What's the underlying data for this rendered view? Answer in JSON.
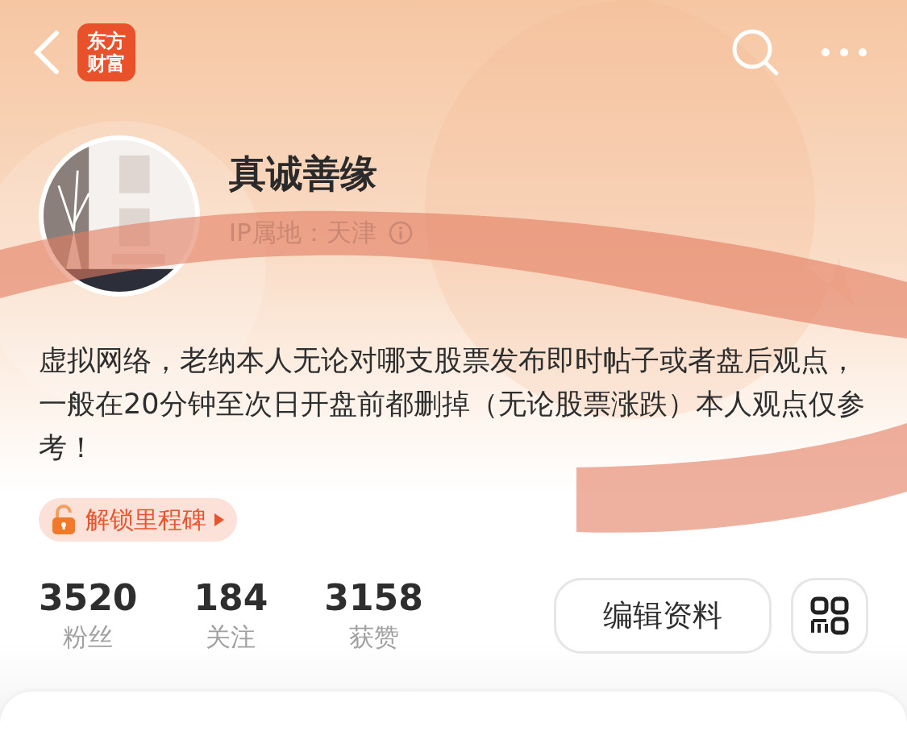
{
  "header": {
    "logo_lines": [
      "东方",
      "财富"
    ]
  },
  "profile": {
    "name": "真诚善缘",
    "ip_location": "IP属地：天津",
    "bio": "虚拟网络，老纳本人无论对哪支股票发布即时帖子或者盘后观点，一般在20分钟至次日开盘前都删掉（无论股票涨跌）本人观点仅参考！",
    "milestone": "解锁里程碑"
  },
  "stats": [
    {
      "value": "3520",
      "label": "粉丝"
    },
    {
      "value": "184",
      "label": "关注"
    },
    {
      "value": "3158",
      "label": "获赞"
    }
  ],
  "edit_button": "编辑资料"
}
